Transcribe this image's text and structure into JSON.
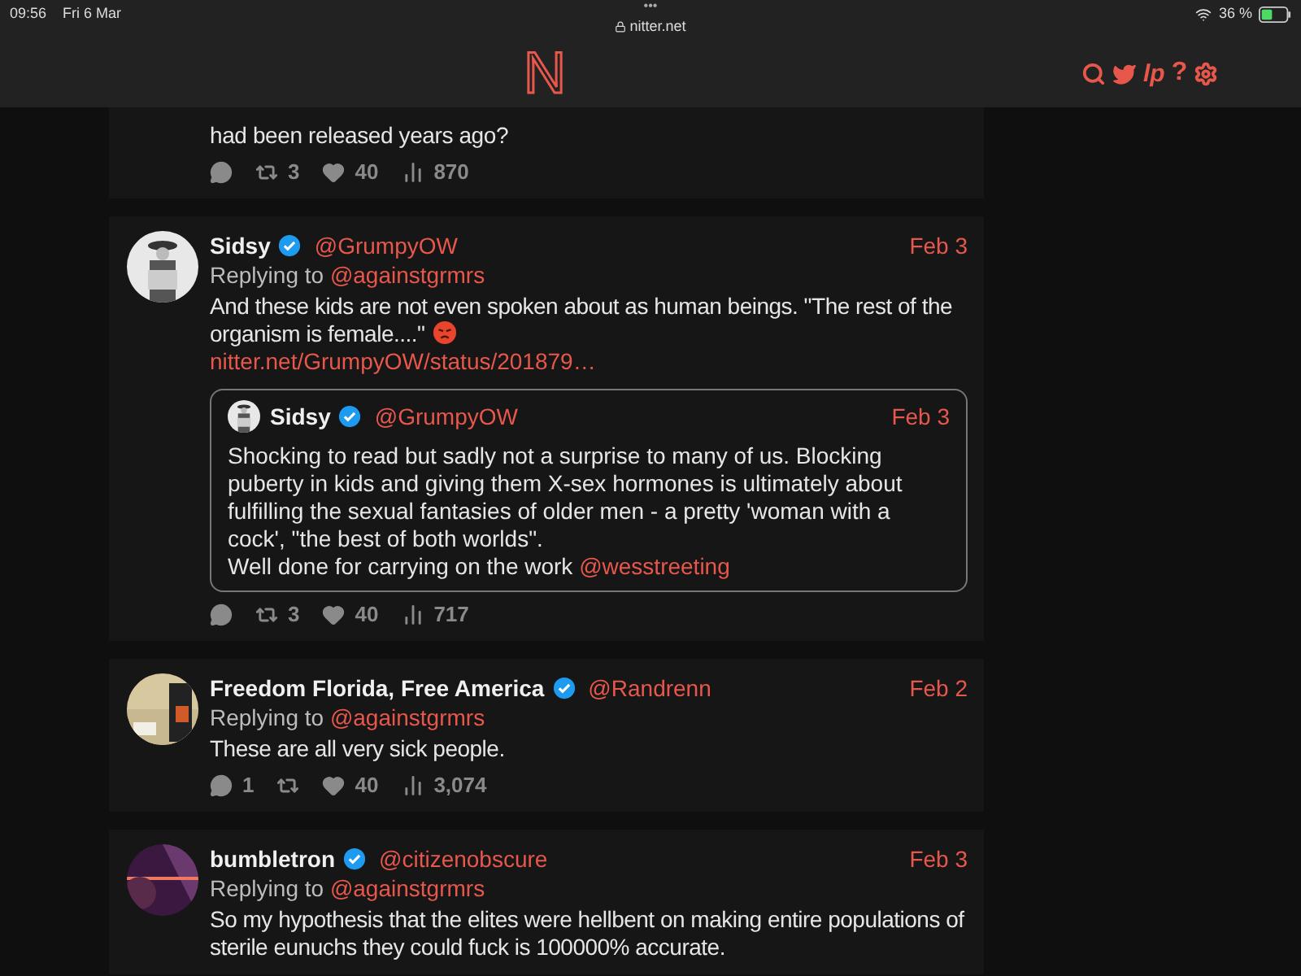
{
  "status_bar": {
    "time": "09:56",
    "date": "Fri 6 Mar",
    "dots": "•••",
    "url": "nitter.net",
    "battery": "36 %"
  },
  "nav": {
    "logo": "N",
    "liberapay": "lp",
    "help": "?"
  },
  "tweets": [
    {
      "body": "had been released years ago?",
      "stats": {
        "retweets": "3",
        "likes": "40",
        "views": "870"
      }
    },
    {
      "name": "Sidsy",
      "verified": true,
      "handle": "@GrumpyOW",
      "date": "Feb 3",
      "replying_label": "Replying to",
      "replying_to": "@againstgrmrs",
      "body": "And these kids are not even spoken about as human beings. \"The rest of the organism is female....\"",
      "emoji": true,
      "link": "nitter.net/GrumpyOW/status/201879…",
      "quote": {
        "name": "Sidsy",
        "verified": true,
        "handle": "@GrumpyOW",
        "date": "Feb 3",
        "body": "Shocking to read but sadly not a surprise to many of us. Blocking puberty in kids and giving them X-sex hormones is ultimately about fulfilling the sexual fantasies of older men - a pretty 'woman with a cock', \"the best of both worlds\".",
        "body2": "Well done for carrying on the work",
        "mention": "@wesstreeting"
      },
      "stats": {
        "retweets": "3",
        "likes": "40",
        "views": "717"
      }
    },
    {
      "name": "Freedom Florida, Free America",
      "verified": true,
      "handle": "@Randrenn",
      "date": "Feb 2",
      "replying_label": "Replying to",
      "replying_to": "@againstgrmrs",
      "body": "These are all very sick people.",
      "stats": {
        "comments": "1",
        "likes": "40",
        "views": "3,074"
      }
    },
    {
      "name": "bumbletron",
      "verified": true,
      "handle": "@citizenobscure",
      "date": "Feb 3",
      "replying_label": "Replying to",
      "replying_to": "@againstgrmrs",
      "body": "So my hypothesis that the elites were hellbent on making entire populations of sterile eunuchs they could fuck is 100000% accurate."
    }
  ]
}
